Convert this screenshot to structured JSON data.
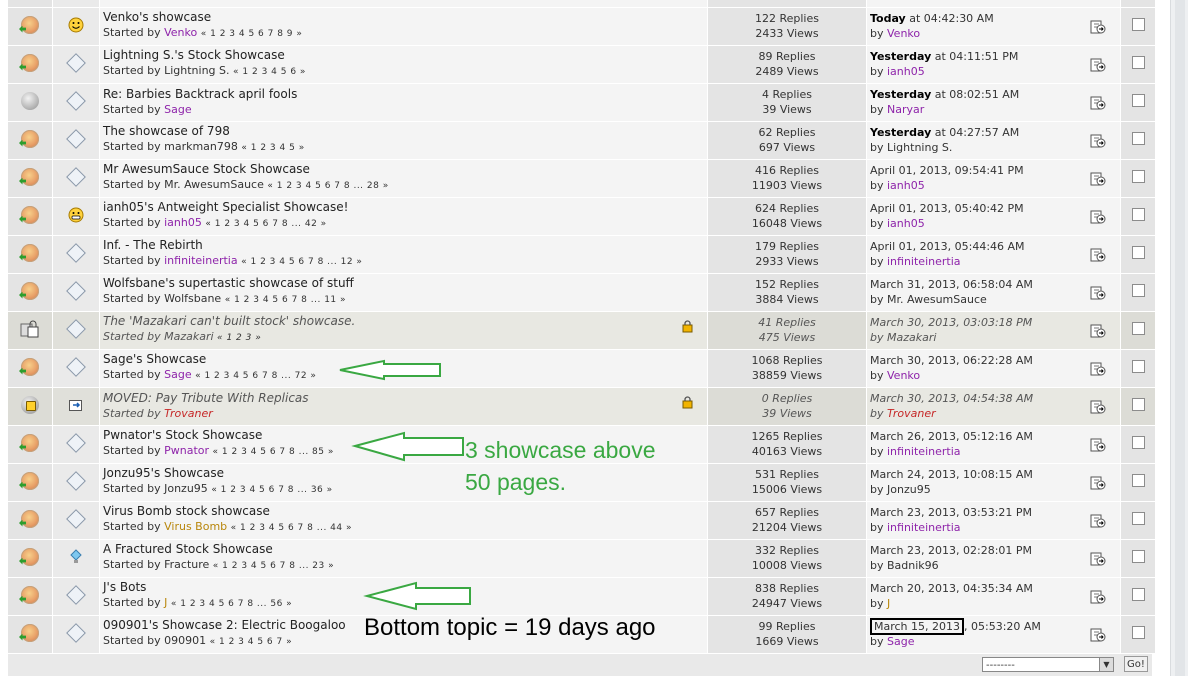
{
  "topics": [
    {
      "status": "hot",
      "icon": "smiley",
      "title": "Venko's showcase",
      "starter": "Venko",
      "starter_class": "user-link",
      "pages": "« 1 2 3 4 5 6 7 8 9 »",
      "replies": "122 Replies",
      "views": "2433 Views",
      "last_when_bold": "Today",
      "last_when_rest": " at 04:42:30 AM",
      "last_by": "Venko",
      "last_by_class": "user-link",
      "locked": false
    },
    {
      "status": "hot",
      "icon": "diamond",
      "title": "Lightning S.'s Stock Showcase",
      "starter": "Lightning S.",
      "starter_class": "",
      "pages": "« 1 2 3 4 5 6 »",
      "replies": "89 Replies",
      "views": "2489 Views",
      "last_when_bold": "Yesterday",
      "last_when_rest": " at 04:11:51 PM",
      "last_by": "ianh05",
      "last_by_class": "user-link",
      "locked": false
    },
    {
      "status": "gray",
      "icon": "diamond",
      "title": "Re: Barbies Backtrack april fools",
      "starter": "Sage",
      "starter_class": "user-link",
      "pages": "",
      "replies": "4 Replies",
      "views": "39 Views",
      "last_when_bold": "Yesterday",
      "last_when_rest": " at 08:02:51 AM",
      "last_by": "Naryar",
      "last_by_class": "user-link",
      "locked": false
    },
    {
      "status": "hot",
      "icon": "diamond",
      "title": "The showcase of 798",
      "starter": "markman798",
      "starter_class": "",
      "pages": "« 1 2 3 4 5 »",
      "replies": "62 Replies",
      "views": "697 Views",
      "last_when_bold": "Yesterday",
      "last_when_rest": " at 04:27:57 AM",
      "last_by": "Lightning S.",
      "last_by_class": "",
      "locked": false
    },
    {
      "status": "hot",
      "icon": "diamond",
      "title": "Mr AwesumSauce Stock Showcase",
      "starter": "Mr. AwesumSauce",
      "starter_class": "",
      "pages": "« 1 2 3 4 5 6 7 8 ... 28 »",
      "replies": "416 Replies",
      "views": "11903 Views",
      "last_when_bold": "",
      "last_when_rest": "April 01, 2013, 09:54:41 PM",
      "last_by": "ianh05",
      "last_by_class": "user-link",
      "locked": false
    },
    {
      "status": "hot",
      "icon": "grin",
      "title": "ianh05's Antweight Specialist Showcase!",
      "starter": "ianh05",
      "starter_class": "user-link",
      "pages": "« 1 2 3 4 5 6 7 8 ... 42 »",
      "replies": "624 Replies",
      "views": "16048 Views",
      "last_when_bold": "",
      "last_when_rest": "April 01, 2013, 05:40:42 PM",
      "last_by": "ianh05",
      "last_by_class": "user-link",
      "locked": false
    },
    {
      "status": "hot",
      "icon": "diamond",
      "title": "Inf. - The Rebirth",
      "starter": "infiniteinertia",
      "starter_class": "user-link",
      "pages": "« 1 2 3 4 5 6 7 8 ... 12 »",
      "replies": "179 Replies",
      "views": "2933 Views",
      "last_when_bold": "",
      "last_when_rest": "April 01, 2013, 05:44:46 AM",
      "last_by": "infiniteinertia",
      "last_by_class": "user-link",
      "locked": false
    },
    {
      "status": "hot",
      "icon": "diamond",
      "title": "Wolfsbane's supertastic showcase of stuff",
      "starter": "Wolfsbane",
      "starter_class": "",
      "pages": "« 1 2 3 4 5 6 7 8 ... 11 »",
      "replies": "152 Replies",
      "views": "3884 Views",
      "last_when_bold": "",
      "last_when_rest": "March 31, 2013, 06:58:04 AM",
      "last_by": "Mr. AwesumSauce",
      "last_by_class": "",
      "locked": false
    },
    {
      "status": "lockedhot",
      "icon": "diamond",
      "title": "The 'Mazakari can't built stock' showcase.",
      "starter": "Mazakari",
      "starter_class": "",
      "pages": "« 1 2 3 »",
      "replies": "41 Replies",
      "views": "475 Views",
      "last_when_bold": "",
      "last_when_rest": "March 30, 2013, 03:03:18 PM",
      "last_by": "Mazakari",
      "last_by_class": "",
      "locked": true
    },
    {
      "status": "hot",
      "icon": "diamond",
      "title": "Sage's Showcase",
      "starter": "Sage",
      "starter_class": "user-link",
      "pages": "« 1 2 3 4 5 6 7 8 ... 72 »",
      "replies": "1068 Replies",
      "views": "38859 Views",
      "last_when_bold": "",
      "last_when_rest": "March 30, 2013, 06:22:28 AM",
      "last_by": "Venko",
      "last_by_class": "user-link",
      "locked": false
    },
    {
      "status": "lock",
      "icon": "moved",
      "title": "MOVED: Pay Tribute With Replicas",
      "starter": "Trovaner",
      "starter_class": "user-red",
      "pages": "",
      "replies": "0 Replies",
      "views": "39 Views",
      "last_when_bold": "",
      "last_when_rest": "March 30, 2013, 04:54:38 AM",
      "last_by": "Trovaner",
      "last_by_class": "user-red",
      "locked": true
    },
    {
      "status": "hot",
      "icon": "diamond",
      "title": "Pwnator's Stock Showcase",
      "starter": "Pwnator",
      "starter_class": "user-link",
      "pages": "« 1 2 3 4 5 6 7 8 ... 85 »",
      "replies": "1265 Replies",
      "views": "40163 Views",
      "last_when_bold": "",
      "last_when_rest": "March 26, 2013, 05:12:16 AM",
      "last_by": "infiniteinertia",
      "last_by_class": "user-link",
      "locked": false
    },
    {
      "status": "hot",
      "icon": "diamond",
      "title": "Jonzu95's Showcase",
      "starter": "Jonzu95",
      "starter_class": "",
      "pages": "« 1 2 3 4 5 6 7 8 ... 36 »",
      "replies": "531 Replies",
      "views": "15006 Views",
      "last_when_bold": "",
      "last_when_rest": "March 24, 2013, 10:08:15 AM",
      "last_by": "Jonzu95",
      "last_by_class": "",
      "locked": false
    },
    {
      "status": "hot",
      "icon": "diamond",
      "title": "Virus Bomb stock showcase",
      "starter": "Virus Bomb",
      "starter_class": "user-gold",
      "pages": "« 1 2 3 4 5 6 7 8 ... 44 »",
      "replies": "657 Replies",
      "views": "21204 Views",
      "last_when_bold": "",
      "last_when_rest": "March 23, 2013, 03:53:21 PM",
      "last_by": "infiniteinertia",
      "last_by_class": "user-link",
      "locked": false
    },
    {
      "status": "hot",
      "icon": "bulb",
      "title": "A Fractured Stock Showcase",
      "starter": "Fracture",
      "starter_class": "",
      "pages": "« 1 2 3 4 5 6 7 8 ... 23 »",
      "replies": "332 Replies",
      "views": "10008 Views",
      "last_when_bold": "",
      "last_when_rest": "March 23, 2013, 02:28:01 PM",
      "last_by": "Badnik96",
      "last_by_class": "",
      "locked": false
    },
    {
      "status": "hot",
      "icon": "diamond",
      "title": "J's Bots",
      "starter": "J",
      "starter_class": "user-gold",
      "pages": "« 1 2 3 4 5 6 7 8 ... 56 »",
      "replies": "838 Replies",
      "views": "24947 Views",
      "last_when_bold": "",
      "last_when_rest": "March 20, 2013, 04:35:34 AM",
      "last_by": "J",
      "last_by_class": "user-gold",
      "locked": false
    },
    {
      "status": "hot",
      "icon": "diamond",
      "title": "090901's Showcase 2: Electric Boogaloo",
      "starter": "090901",
      "starter_class": "",
      "pages": "« 1 2 3 4 5 6 7 »",
      "replies": "99 Replies",
      "views": "1669 Views",
      "last_when_bold": "",
      "last_when_rest": "March 15, 2013, 05:53:20 AM",
      "last_by": "Sage",
      "last_by_class": "user-link",
      "locked": false
    }
  ],
  "labels": {
    "started_by": "Started by ",
    "by": "by "
  },
  "annotations": {
    "showcase_note_line1": "3 showcase above",
    "showcase_note_line2": "50 pages.",
    "bottom_note": "Bottom topic = 19 days ago",
    "highlight_date": "March 15, 2013",
    "highlight_rest": ", 05:53:20 AM",
    "note_color": "#3aa842",
    "arrow_color": "#3aa842"
  },
  "footer": {
    "jump_value": "--------",
    "go_label": "Go!"
  }
}
